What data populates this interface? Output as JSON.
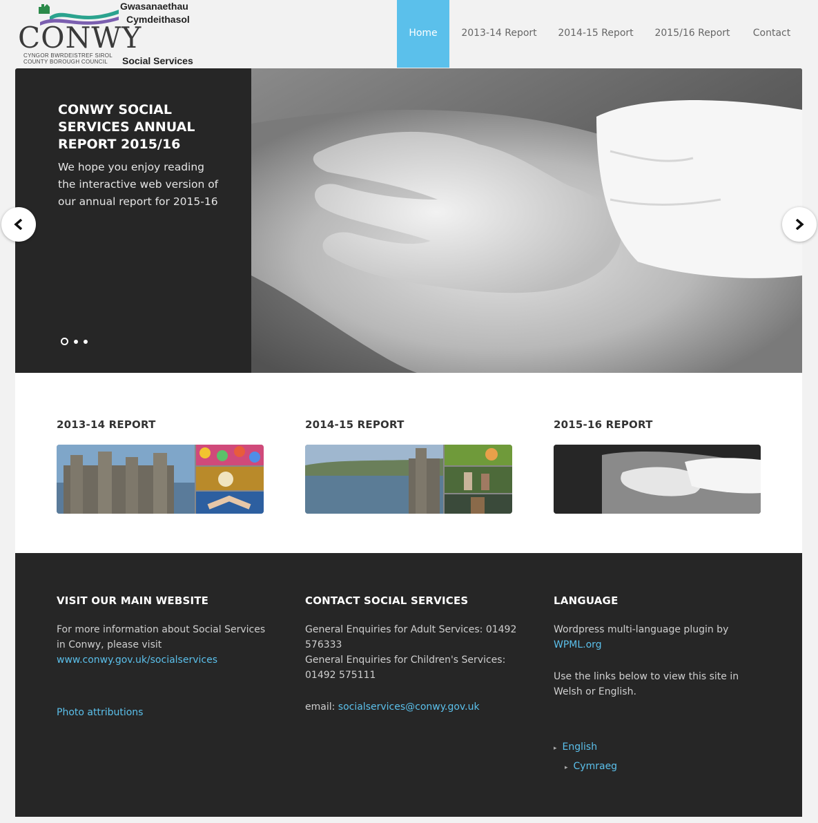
{
  "logo": {
    "name": "CONWY",
    "council_line1": "CYNGOR BWRDEISTREF SIROL",
    "council_line2": "COUNTY BOROUGH COUNCIL",
    "welsh_line1": "Gwasanaethau",
    "welsh_line2": "Cymdeithasol",
    "english": "Social Services"
  },
  "nav": {
    "items": [
      {
        "label": "Home",
        "active": true
      },
      {
        "label": "2013-14 Report"
      },
      {
        "label": "2014-15 Report"
      },
      {
        "label": "2015/16 Report"
      },
      {
        "label": "Contact"
      }
    ]
  },
  "slider": {
    "title": "CONWY SOCIAL SERVICES ANNUAL REPORT 2015/16",
    "body": "We hope you enjoy reading the interactive web version of our annual report for 2015-16",
    "active_slide": 1,
    "slide_count": 3,
    "prev_icon": "chevron-left-icon",
    "next_icon": "chevron-right-icon"
  },
  "reports": [
    {
      "title": "2013-14 REPORT"
    },
    {
      "title": "2014-15 REPORT"
    },
    {
      "title": "2015-16 REPORT"
    }
  ],
  "footer": {
    "visit": {
      "heading": "VISIT OUR MAIN WEBSITE",
      "text": "For more information about Social Services in Conwy, please visit",
      "link": "www.conwy.gov.uk/socialservices",
      "attributions": "Photo attributions"
    },
    "contact": {
      "heading": "CONTACT SOCIAL SERVICES",
      "adult": "General Enquiries for Adult Services: 01492 576333",
      "children": "General Enquiries for Children's Services: 01492 575111",
      "email_label": "email:",
      "email": "socialservices@conwy.gov.uk"
    },
    "language": {
      "heading": "LANGUAGE",
      "plugin_text": "Wordpress multi-language plugin by",
      "plugin_link": "WPML.org",
      "instructions": "Use the links below to view this site in Welsh or English.",
      "links": [
        "English",
        "Cymraeg"
      ]
    }
  },
  "colors": {
    "accent": "#5bc0eb",
    "dark": "#262626",
    "background": "#f2f2f2"
  }
}
